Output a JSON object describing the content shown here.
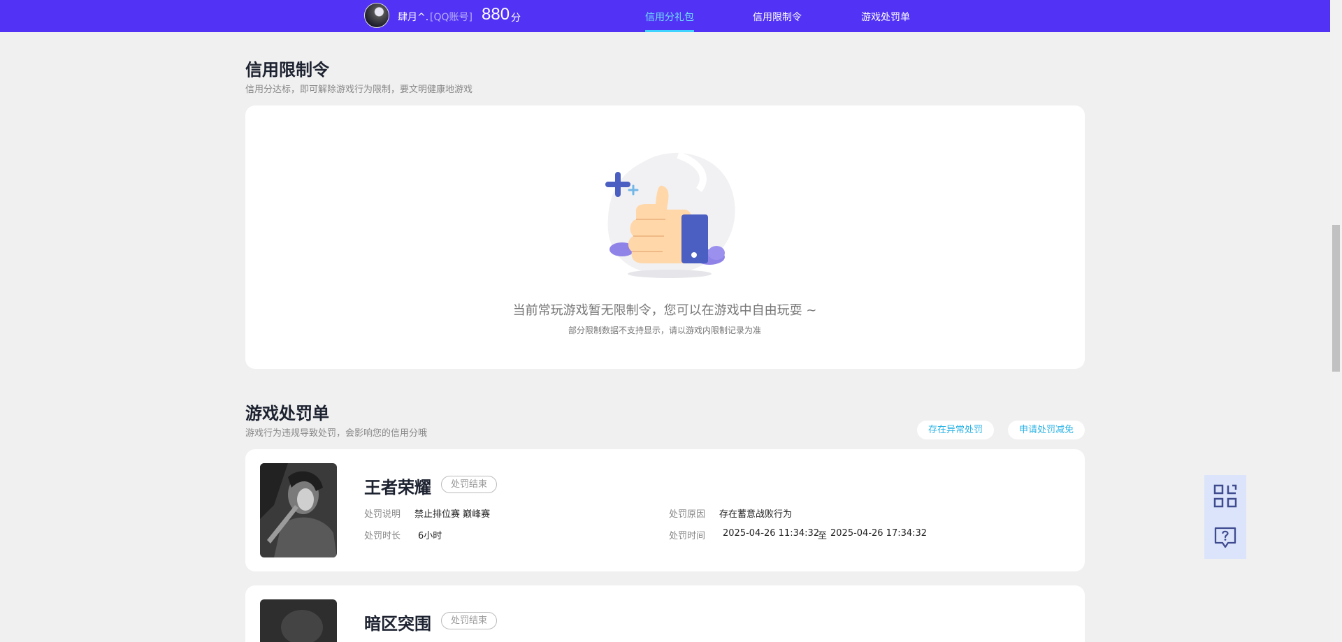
{
  "header": {
    "username": "肆月^.",
    "account_type": "[QQ账号]",
    "score": "880",
    "score_unit": "分",
    "nav": [
      "信用分礼包",
      "信用限制令",
      "游戏处罚单"
    ]
  },
  "restriction": {
    "title": "信用限制令",
    "subtitle": "信用分达标，即可解除游戏行为限制，要文明健康地游戏",
    "empty_main": "当前常玩游戏暂无限制令，您可以在游戏中自由玩耍 ~",
    "empty_sub": "部分限制数据不支持显示，请以游戏内限制记录为准"
  },
  "penalty": {
    "title": "游戏处罚单",
    "subtitle": "游戏行为违规导致处罚，会影响您的信用分哦",
    "btn_abnormal": "存在异常处罚",
    "btn_reduce": "申请处罚减免",
    "items": [
      {
        "game": "王者荣耀",
        "status": "处罚结束",
        "desc_label": "处罚说明",
        "desc": "禁止排位赛 巅峰赛",
        "duration_label": "处罚时长",
        "duration": "6小时",
        "reason_label": "处罚原因",
        "reason": "存在蓄意战败行为",
        "time_label": "处罚时间",
        "time_start": "2025-04-26 11:34:32",
        "time_sep": "至",
        "time_end": "2025-04-26 17:34:32"
      },
      {
        "game": "暗区突围",
        "status": "处罚结束"
      }
    ]
  },
  "tools": {
    "qr_icon": "qr-code-icon",
    "help_icon": "question-bubble-icon"
  },
  "colors": {
    "header_bg": "#5233f5",
    "nav_active": "#6fe0ff",
    "accent_blue": "#2bb3e6",
    "page_bg": "#f0f0f0"
  }
}
